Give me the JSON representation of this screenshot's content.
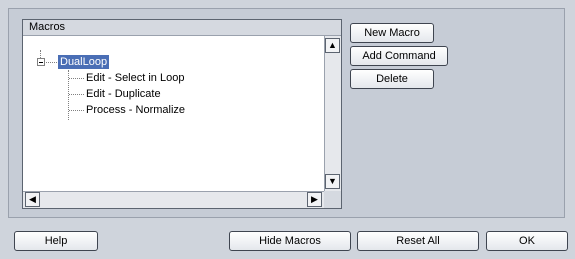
{
  "macros": {
    "header": "Macros",
    "tree": {
      "root": "DualLoop",
      "children": [
        "Edit - Select in Loop",
        "Edit - Duplicate",
        "Process - Normalize"
      ]
    }
  },
  "side_buttons": {
    "new_macro": "New Macro",
    "add_command": "Add Command",
    "delete": "Delete"
  },
  "bottom_buttons": {
    "help": "Help",
    "hide_macros": "Hide Macros",
    "reset_all": "Reset All",
    "ok": "OK"
  },
  "icons": {
    "scroll_up": "▲",
    "scroll_down": "▼",
    "scroll_left": "◀",
    "scroll_right": "▶"
  }
}
